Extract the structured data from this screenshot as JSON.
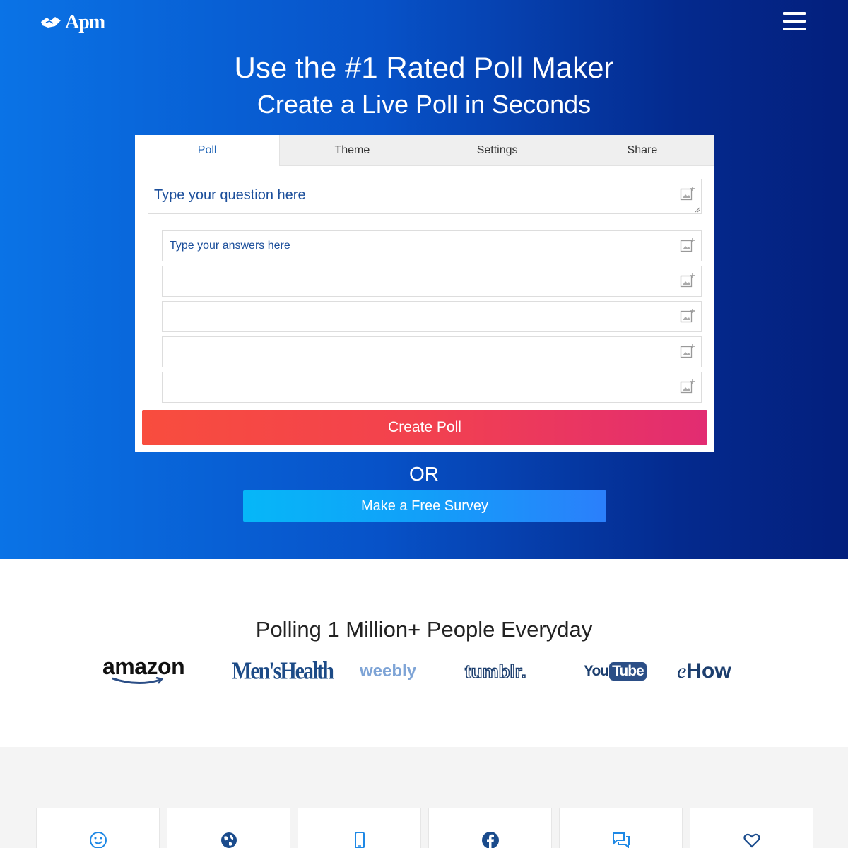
{
  "brand": {
    "logo_text": "pm",
    "logo_prefix": "A"
  },
  "hero": {
    "title": "Use the #1 Rated Poll Maker",
    "subtitle": "Create a Live Poll in Seconds"
  },
  "poll_card": {
    "tabs": [
      {
        "label": "Poll",
        "active": true
      },
      {
        "label": "Theme",
        "active": false
      },
      {
        "label": "Settings",
        "active": false
      },
      {
        "label": "Share",
        "active": false
      }
    ],
    "question_placeholder": "Type your question here",
    "answers": [
      {
        "placeholder": "Type your answers here",
        "value": ""
      },
      {
        "placeholder": "",
        "value": ""
      },
      {
        "placeholder": "",
        "value": ""
      },
      {
        "placeholder": "",
        "value": ""
      },
      {
        "placeholder": "",
        "value": ""
      }
    ],
    "create_label": "Create Poll"
  },
  "or_label": "OR",
  "survey_label": "Make a Free Survey",
  "social_proof": {
    "title": "Polling 1 Million+ People Everyday",
    "brands": {
      "amazon": "amazon",
      "menshealth": "Men'sHealth",
      "weebly": "weebly",
      "tumblr": "tumblr.",
      "youtube_you": "You",
      "youtube_tube": "Tube",
      "ehow_e": "e",
      "ehow_rest": "How"
    }
  },
  "features": {
    "icons": [
      "smiley-icon",
      "globe-icon",
      "mobile-icon",
      "facebook-icon",
      "chat-icon",
      "heart-icon"
    ]
  },
  "colors": {
    "hero_gradient": [
      "#0a73e6",
      "#031f7d"
    ],
    "create_button": [
      "#f84d3e",
      "#e22c72"
    ],
    "survey_button": [
      "#06b7f8",
      "#2b7ffb"
    ],
    "accent_blue": "#1e63b5"
  }
}
